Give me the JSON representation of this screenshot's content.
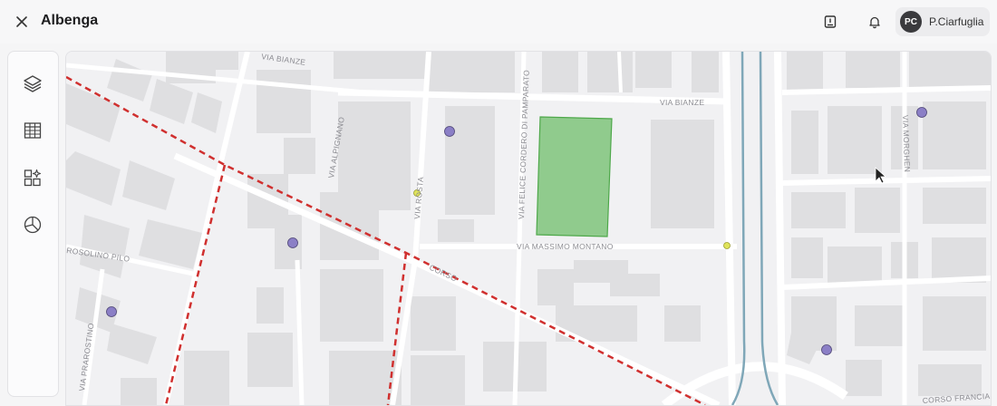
{
  "header": {
    "title": "Albenga",
    "close_icon": "close-icon",
    "report_icon": "report-icon",
    "bell_icon": "bell-icon",
    "user": {
      "initials": "PC",
      "name": "P.Ciarfuglia"
    }
  },
  "toolbar": {
    "items": [
      {
        "icon": "layers-icon"
      },
      {
        "icon": "table-icon"
      },
      {
        "icon": "widgets-icon"
      },
      {
        "icon": "pie-chart-icon"
      }
    ]
  },
  "map": {
    "colors": {
      "background": "#f1f1f3",
      "building": "#dfdfe1",
      "road": "#ffffff",
      "rail": "#7fa7b8",
      "highlight_fill": "#7fc47a",
      "highlight_stroke": "#4ea84a",
      "dashed_line": "#d0302f",
      "poi": "#8b7fc6",
      "stop": "#dfe35a"
    },
    "street_labels": {
      "via_bianze_top": "VIA BIANZE",
      "via_bianze": "VIA BIANZE",
      "via_felice": "VIA FELICE CORDERO DI PAMPARATO",
      "via_massimo": "VIA MASSIMO MONTANO",
      "via_pignano": "VIA ALPIGNANO",
      "via_rosta": "VIA ROSTA",
      "via_morghen": "VIA MORGHEN",
      "rosolino_pilo": "ROSOLINO PILO",
      "via_prarostino": "VIA PRAROSTINO",
      "corso_francia": "CORSO FRANCIA",
      "corso_label": "CORSO"
    }
  }
}
